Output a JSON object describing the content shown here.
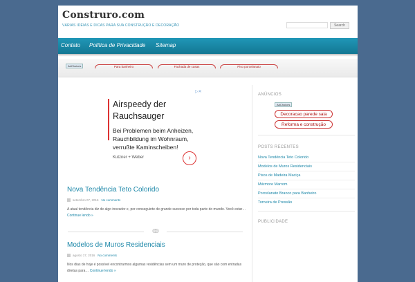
{
  "site": {
    "title": "Construro.com",
    "description": "VÁRIAS IDÉIAS E DICAS PARA SUA CONSTRUÇÃO E DECORAÇÃO",
    "search_button": "Search"
  },
  "nav": {
    "items": [
      "Contato",
      "Política de Privacidade",
      "Sitemap"
    ]
  },
  "ad_strip": {
    "adchoices": "AdChoices",
    "pills": [
      "Para banheiro",
      "Fachada de casas",
      "Piso porcelanato"
    ]
  },
  "ad": {
    "marker": "▷✕",
    "headline_line1": "Airspeedy der",
    "headline_line2": "Rauchsauger",
    "body_line1": "Bei Problemen beim Anheizen,",
    "body_line2": "Rauchbildung im Wohnraum,",
    "body_line3": "verrußte Kaminscheiben!",
    "brand": "Kutzner + Weber",
    "go": "›"
  },
  "posts": [
    {
      "title": "Nova Tendência Teto Colorido",
      "date": "setembro 07, 2016",
      "comments": "No comments",
      "excerpt": "A atual tendência diz de algo inovador e, por conseguinte de grande sucesso por toda parte do mundo. Você estar…",
      "more": "Continue lendo »"
    },
    {
      "title": "Modelos de Muros Residenciais",
      "date": "agosto 17, 2016",
      "comments": "No comments",
      "excerpt": "Nos dias de hoje é possível encontrarmos algumas residências sem um muro de proteção, que são com entradas diretas para…",
      "more": "Continue lendo »"
    }
  ],
  "divider_ornament": "ↂ",
  "sidebar": {
    "ads_title": "ANÚNCIOS",
    "adchoices": "AdChoices",
    "ad_pills": [
      "Decoracao parede sala",
      "Reforma e construção"
    ],
    "recent_title": "POSTS RECENTES",
    "recent_posts": [
      "Nova Tendência Teto Colorido",
      "Modelos de Muros Residenciais",
      "Pisos de Madeira Maciça",
      "Mármore Marrom",
      "Porcelanato Branco para Banheiro",
      "Torneira de Pressão"
    ],
    "publicity_title": "PUBLICIDADE"
  },
  "colors": {
    "background": "#4a6a8f",
    "accent": "#1c87a8",
    "ribbon": "#1a87a6",
    "ad_red": "#cc3333"
  }
}
